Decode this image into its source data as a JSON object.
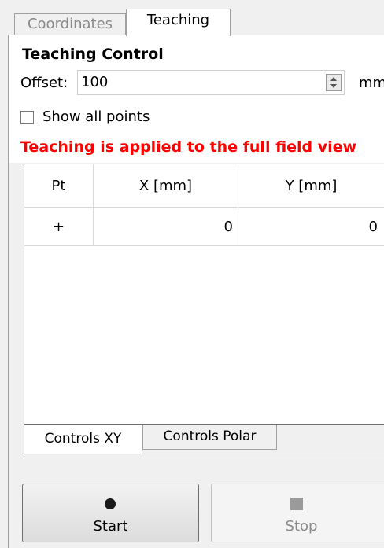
{
  "tabs": {
    "coordinates": "Coordinates",
    "teaching": "Teaching"
  },
  "teaching_control": {
    "title": "Teaching Control",
    "offset_label": "Offset:",
    "offset_value": "100",
    "offset_unit": "mm",
    "show_all_points_label": "Show all points",
    "show_all_points_checked": false,
    "notice": "Teaching is applied to the full field view"
  },
  "table": {
    "columns": [
      "Pt",
      "X [mm]",
      "Y [mm]"
    ],
    "rows": [
      {
        "pt": "+",
        "x": "0",
        "y": "0"
      }
    ]
  },
  "control_tabs": {
    "xy": "Controls XY",
    "polar": "Controls Polar"
  },
  "buttons": {
    "start": "Start",
    "stop": "Stop"
  },
  "colors": {
    "notice": "#ff0000"
  }
}
